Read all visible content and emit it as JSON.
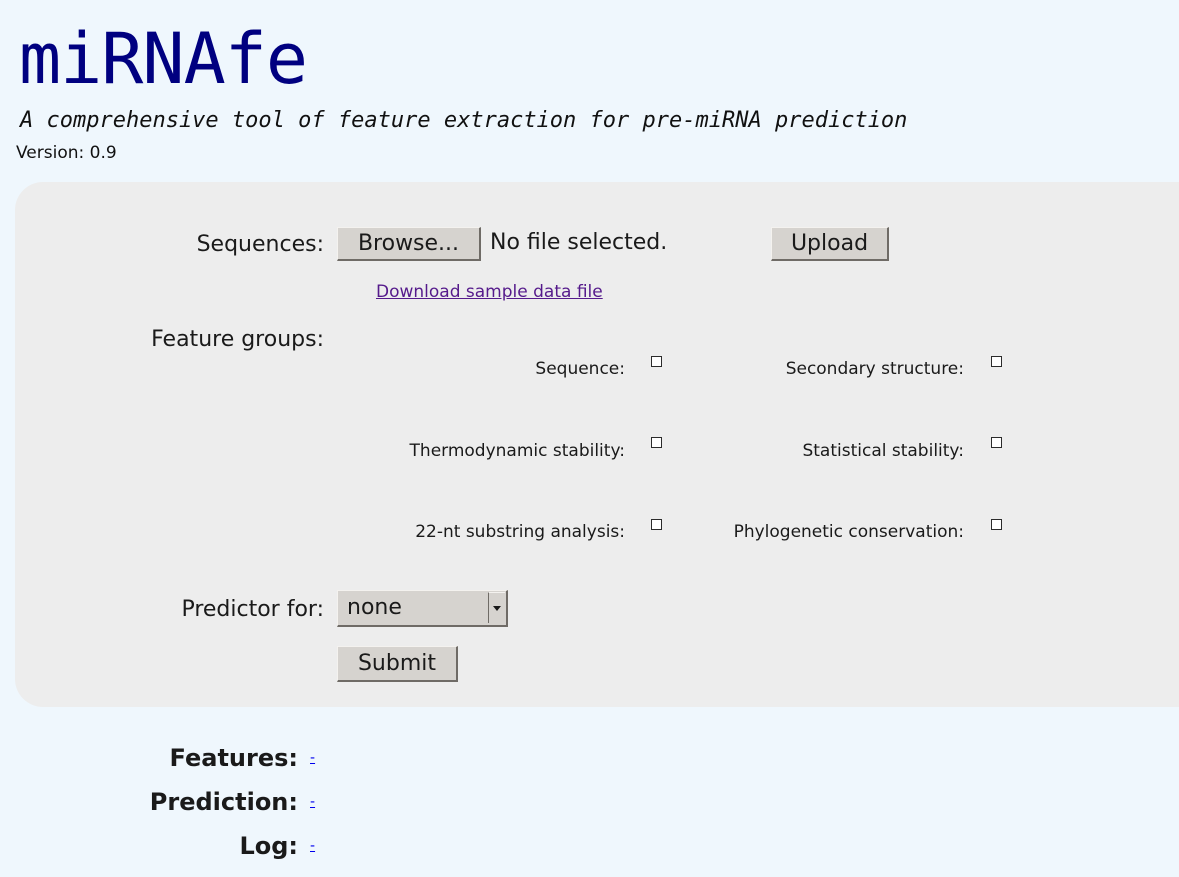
{
  "header": {
    "title": "miRNAfe",
    "subtitle": "A comprehensive tool of feature extraction for pre-miRNA prediction",
    "version": "Version: 0.9"
  },
  "form": {
    "sequences_label": "Sequences:",
    "browse_label": "Browse...",
    "file_status": "No file selected.",
    "upload_label": "Upload",
    "sample_link": "Download sample data file",
    "feature_groups_label": "Feature groups:",
    "feature_groups": [
      {
        "label": "Sequence:",
        "checked": false
      },
      {
        "label": "Secondary structure:",
        "checked": false
      },
      {
        "label": "Thermodynamic stability:",
        "checked": false
      },
      {
        "label": "Statistical stability:",
        "checked": false
      },
      {
        "label": "22-nt substring analysis:",
        "checked": false
      },
      {
        "label": "Phylogenetic conservation:",
        "checked": false
      }
    ],
    "predictor_label": "Predictor for:",
    "predictor_value": "none",
    "submit_label": "Submit"
  },
  "outputs": [
    {
      "label": "Features:",
      "link": "-"
    },
    {
      "label": "Prediction:",
      "link": "-"
    },
    {
      "label": "Log:",
      "link": "-"
    }
  ],
  "colors": {
    "background": "#eff7fd",
    "panel": "#ededed",
    "title": "#000080",
    "visited_link": "#551a8b",
    "link": "#0000ee"
  }
}
